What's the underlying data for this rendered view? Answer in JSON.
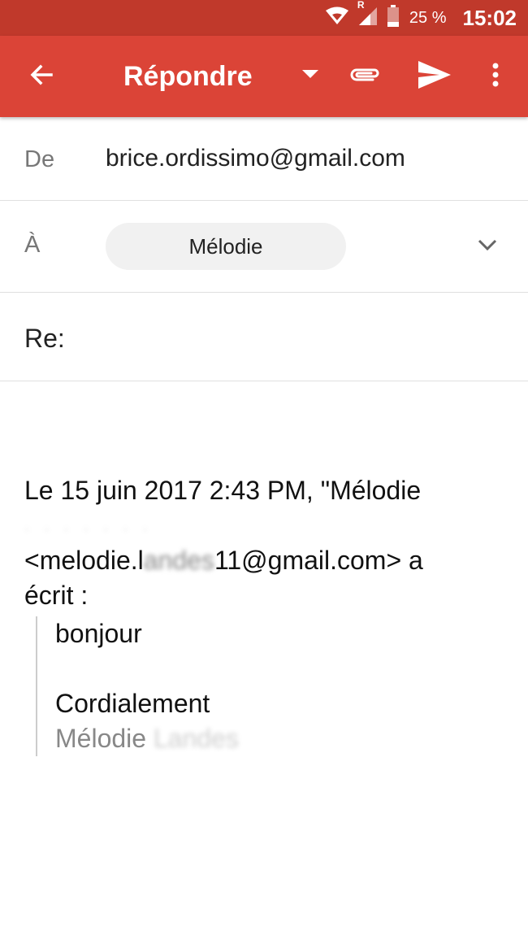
{
  "status_bar": {
    "roaming": "R",
    "battery": "25 %",
    "time": "15:02"
  },
  "app_bar": {
    "title": "Répondre",
    "icons": [
      "arrow-back-icon",
      "dropdown-arrow-icon",
      "paperclip-icon",
      "send-icon",
      "more-vert-icon"
    ]
  },
  "from": {
    "label": "De",
    "value": "brice.ordissimo@gmail.com"
  },
  "to": {
    "label": "À",
    "chip": "Mélodie"
  },
  "subject": {
    "value": "Re:"
  },
  "body": {
    "header_line1": "Le 15 juin 2017 2:43 PM, \"Mélodie",
    "email_prefix": "<melodie.l",
    "email_blurred": "andes",
    "email_suffix": "11@gmail.com> a",
    "header_line3": "écrit :",
    "quote_line1": "bonjour",
    "quote_line2": "Cordialement",
    "signature_name": "Mélodie",
    "signature_blurred": "Landes"
  },
  "colors": {
    "status_bar": "#c0392b",
    "app_bar": "#db4437",
    "chip_bg": "#f1f1f1"
  }
}
